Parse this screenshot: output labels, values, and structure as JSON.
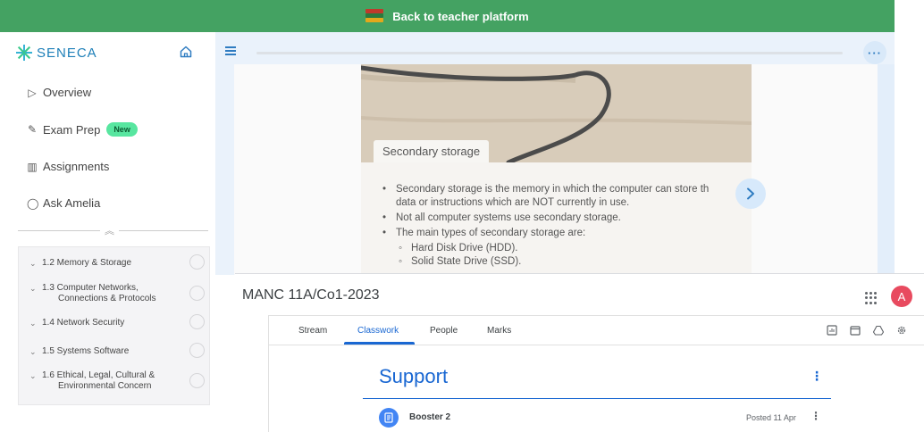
{
  "banner": {
    "label": "Back to teacher platform",
    "icon": "books-icon"
  },
  "seneca": {
    "logo": "SENECA",
    "nav": [
      {
        "icon": "play-outline-icon",
        "label": "Overview"
      },
      {
        "icon": "pencil-icon",
        "label": "Exam Prep",
        "badge": "New"
      },
      {
        "icon": "books-stack-icon",
        "label": "Assignments"
      },
      {
        "icon": "chat-bubble-icon",
        "label": "Ask Amelia"
      }
    ],
    "topics": [
      {
        "line1": "1.2 Memory & Storage",
        "line2": ""
      },
      {
        "line1": "1.3 Computer Networks,",
        "line2": "Connections & Protocols"
      },
      {
        "line1": "1.4 Network Security",
        "line2": ""
      },
      {
        "line1": "1.5 Systems Software",
        "line2": ""
      },
      {
        "line1": "1.6 Ethical, Legal, Cultural &",
        "line2": "Environmental Concern"
      }
    ],
    "card": {
      "caption": "Secondary storage",
      "bullets": [
        {
          "level": 1,
          "text": "Secondary storage is the memory in which the computer can store th"
        },
        {
          "level": 1,
          "text": "data or instructions which are NOT currently in use.",
          "continuation": true
        },
        {
          "level": 1,
          "text": "Not all computer systems use secondary storage."
        },
        {
          "level": 1,
          "text": "The main types of secondary storage are:"
        },
        {
          "level": 2,
          "text": "Hard Disk Drive (HDD)."
        },
        {
          "level": 2,
          "text": "Solid State Drive (SSD)."
        }
      ]
    }
  },
  "classroom": {
    "title": "MANC 11A/Co1-2023",
    "avatar_letter": "A",
    "tabs": [
      "Stream",
      "Classwork",
      "People",
      "Marks"
    ],
    "active_tab": "Classwork",
    "section_title": "Support",
    "item": {
      "title": "Booster 2",
      "date": "Posted 11 Apr"
    }
  },
  "colors": {
    "banner_green": "#44a262",
    "seneca_blue": "#2f7cc1",
    "classroom_blue": "#1967d2",
    "avatar_red": "#e84a5f"
  }
}
